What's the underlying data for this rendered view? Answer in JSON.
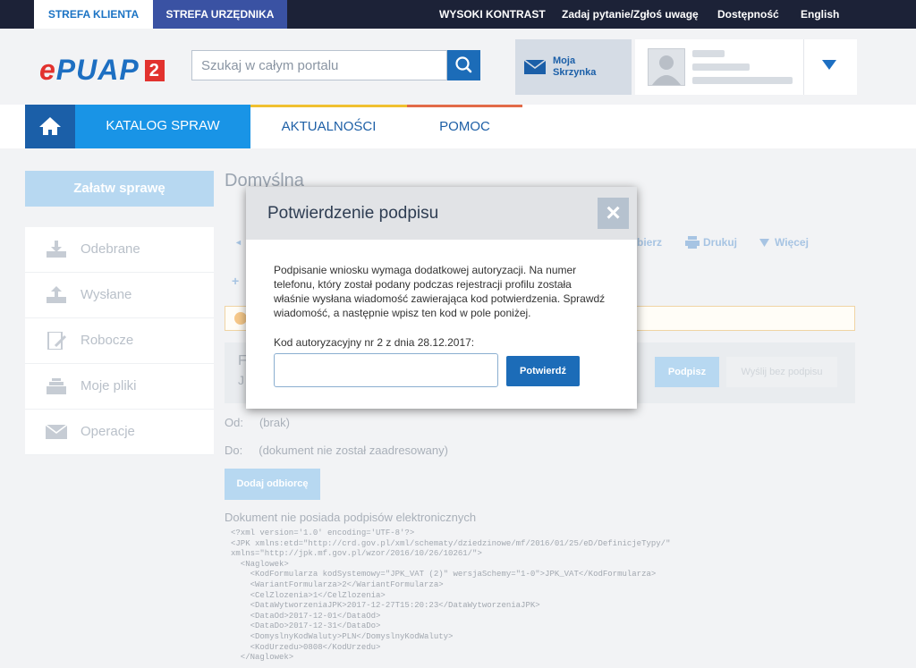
{
  "top_bar": {
    "tab_klient": "STREFA KLIENTA",
    "tab_urzednik": "STREFA URZĘDNIKA",
    "links": [
      "WYSOKI KONTRAST",
      "Zadaj pytanie/Zgłoś uwagę",
      "Dostępność",
      "English"
    ]
  },
  "header": {
    "logo_main": "PUAP",
    "logo_e": "e",
    "logo_version": "2",
    "search_placeholder": "Szukaj w całym portalu",
    "mailbox_label": "Moja Skrzynka"
  },
  "nav": {
    "items": [
      "KATALOG SPRAW",
      "AKTUALNOŚCI",
      "POMOC"
    ]
  },
  "sidebar": {
    "cta": "Załatw sprawę",
    "items": [
      "Odebrane",
      "Wysłane",
      "Robocze",
      "Moje pliki",
      "Operacje"
    ]
  },
  "main": {
    "title": "Domyślna",
    "toolbar": [
      "bierz",
      "Drukuj",
      "Więcej"
    ],
    "sign_button": "Podpisz",
    "send_unsigned_button": "Wyślij bez podpisu",
    "from_label": "Od:",
    "from_value": "(brak)",
    "to_label": "Do:",
    "to_value": "(dokument nie został zaadresowany)",
    "add_recipient_button": "Dodaj odbiorcę",
    "no_signatures": "Dokument nie posiada podpisów elektronicznych",
    "xml_lines": [
      "<?xml version='1.0' encoding='UTF-8'?>",
      "<JPK xmlns:etd=\"http://crd.gov.pl/xml/schematy/dziedzinowe/mf/2016/01/25/eD/DefinicjeTypy/\"",
      "xmlns=\"http://jpk.mf.gov.pl/wzor/2016/10/26/10261/\">",
      "  <Naglowek>",
      "    <KodFormularza kodSystemowy=\"JPK_VAT (2)\" wersjaSchemy=\"1-0\">JPK_VAT</KodFormularza>",
      "    <WariantFormularza>2</WariantFormularza>",
      "    <CelZlozenia>1</CelZlozenia>",
      "    <DataWytworzeniaJPK>2017-12-27T15:20:23</DataWytworzeniaJPK>",
      "    <DataOd>2017-12-01</DataOd>",
      "    <DataDo>2017-12-31</DataDo>",
      "    <DomyslnyKodWaluty>PLN</DomyslnyKodWaluty>",
      "    <KodUrzedu>0808</KodUrzedu>",
      "  </Naglowek>"
    ]
  },
  "modal": {
    "title": "Potwierdzenie podpisu",
    "close_symbol": "×",
    "body": "Podpisanie wniosku wymaga dodatkowej autoryzacji. Na numer telefonu, który został podany podczas rejestracji profilu została właśnie wysłana wiadomość zawierająca kod potwierdzenia. Sprawdź wiadomość, a następnie wpisz ten kod w pole poniżej.",
    "code_label": "Kod autoryzacyjny nr 2 z dnia 28.12.2017:",
    "code_value": "",
    "confirm_button": "Potwierdź"
  },
  "colors": {
    "top_bar": "#1c2237",
    "brand_blue": "#1c6cb8",
    "nav_active": "#1994e6",
    "logo_red": "#e2322e"
  }
}
